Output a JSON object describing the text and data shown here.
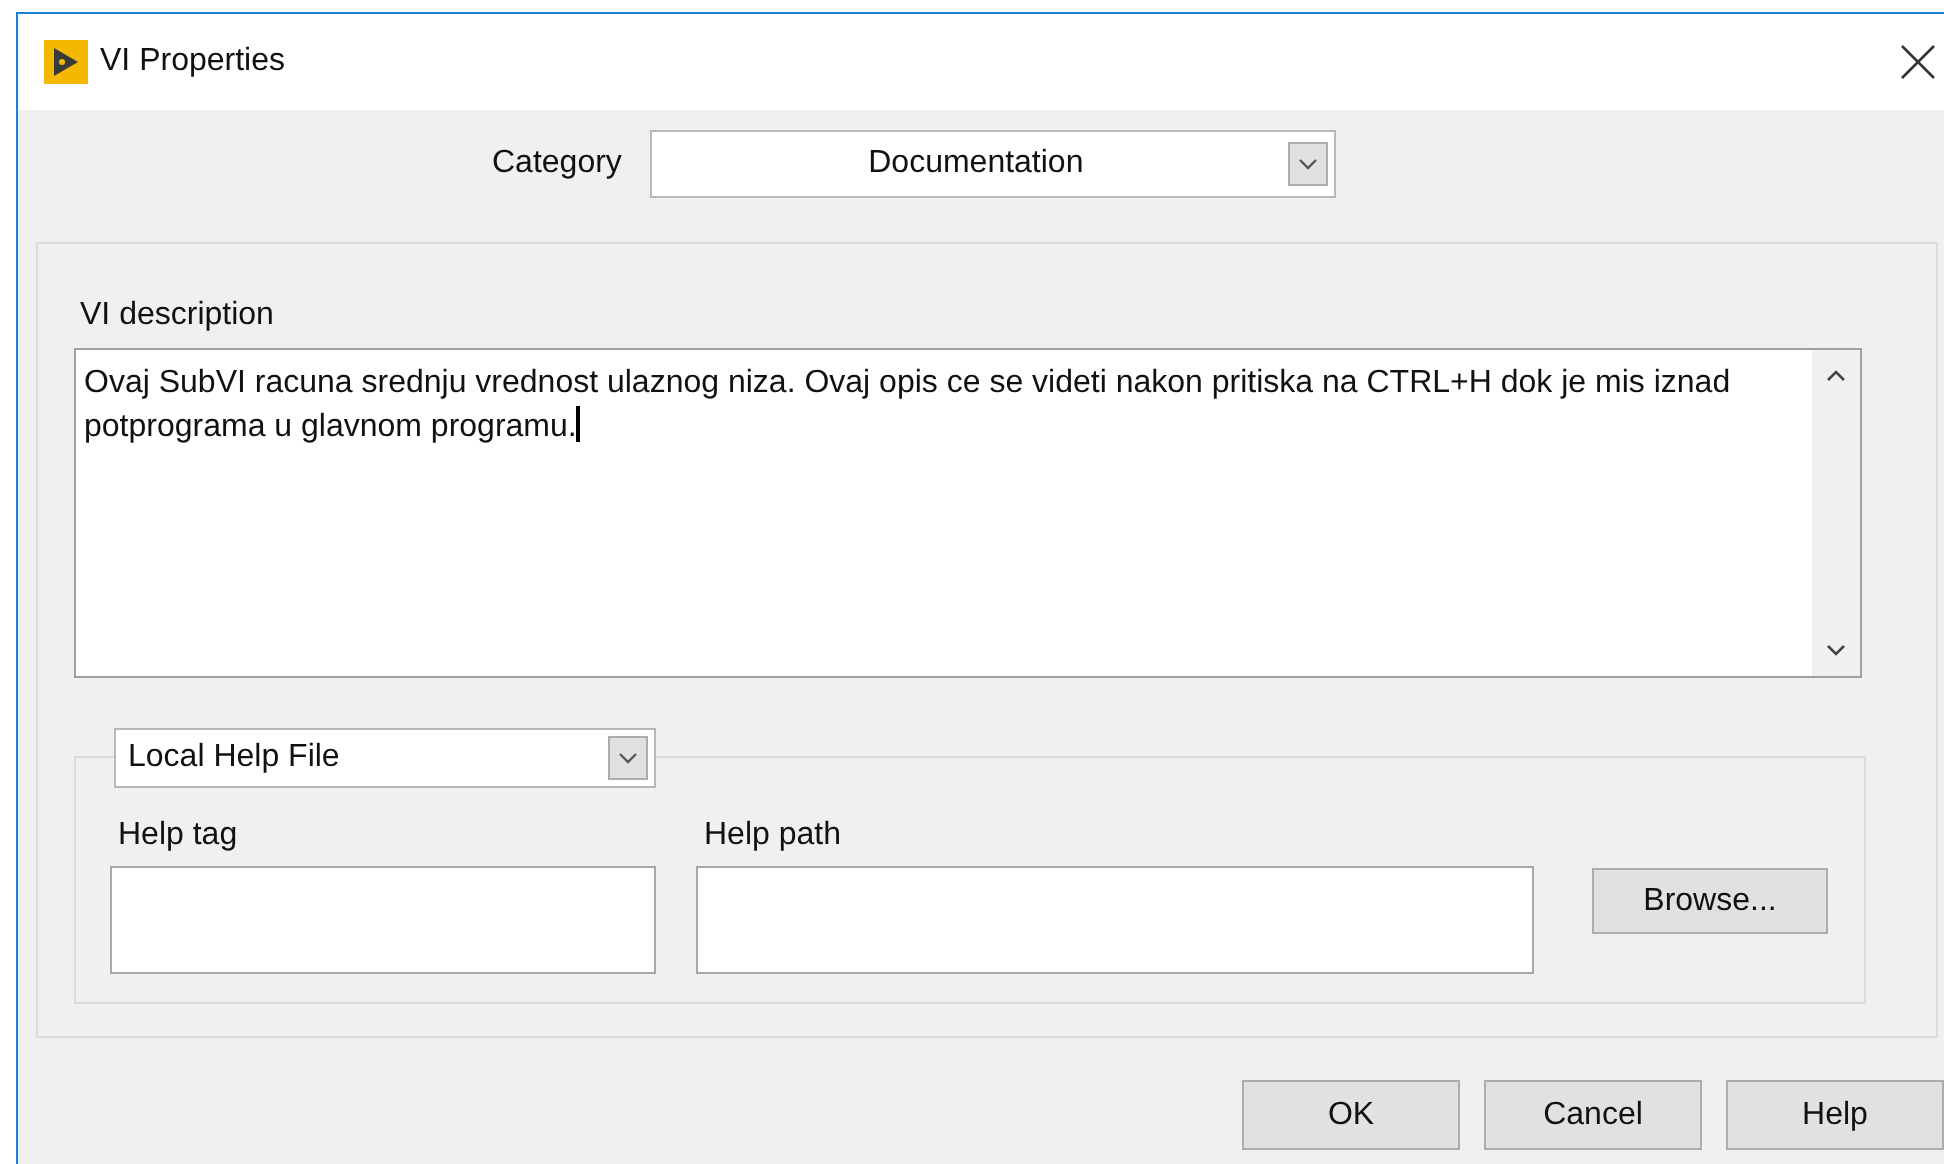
{
  "window": {
    "title": "VI Properties"
  },
  "category": {
    "label": "Category",
    "value": "Documentation"
  },
  "description": {
    "label": "VI description",
    "value": "Ovaj SubVI racuna srednju vrednost ulaznog niza. Ovaj opis ce se videti nakon pritiska na CTRL+H dok je mis iznad potprograma u glavnom programu.",
    "focused": true
  },
  "help": {
    "source": "Local Help File",
    "tag_label": "Help tag",
    "path_label": "Help path",
    "browse": "Browse..."
  },
  "buttons": [
    "OK",
    "Cancel",
    "Help"
  ]
}
